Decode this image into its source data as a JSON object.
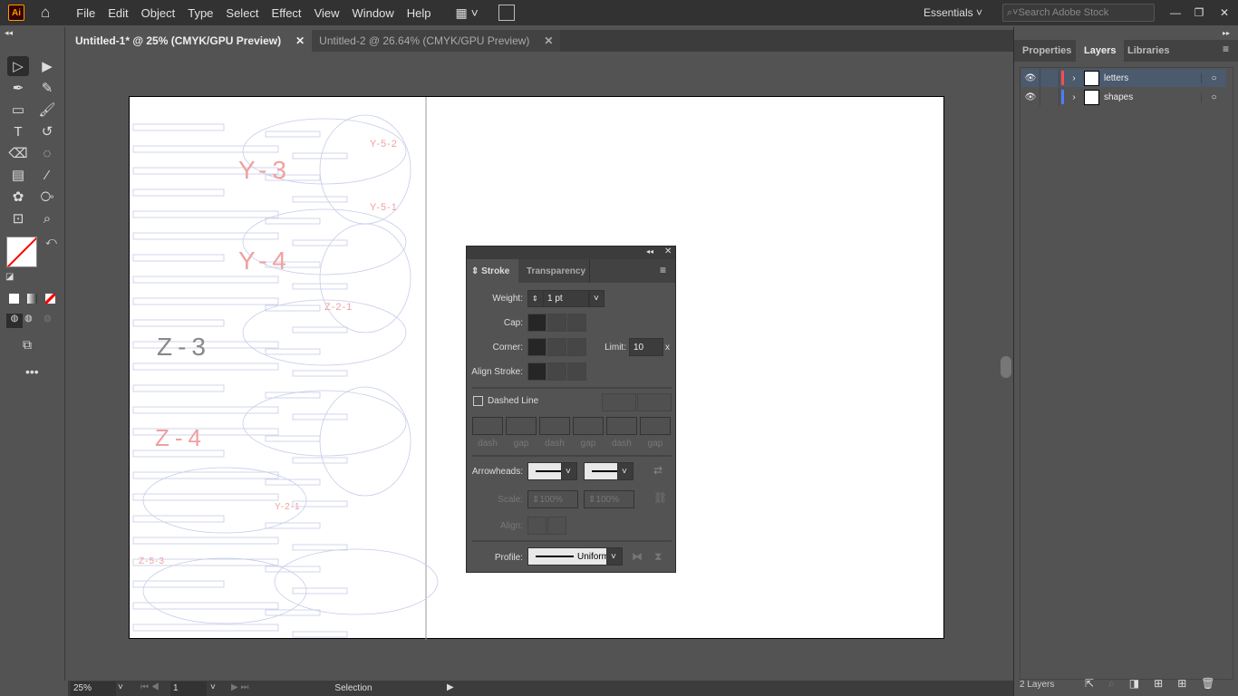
{
  "app": {
    "logo": "Ai",
    "workspace": "Essentials",
    "search_placeholder": "Search Adobe Stock"
  },
  "menu": [
    "File",
    "Edit",
    "Object",
    "Type",
    "Select",
    "Effect",
    "View",
    "Window",
    "Help"
  ],
  "tabs": [
    {
      "label": "Untitled-1* @ 25% (CMYK/GPU Preview)",
      "active": true
    },
    {
      "label": "Untitled-2 @ 26.64% (CMYK/GPU Preview)",
      "active": false
    }
  ],
  "tools": [
    "selection-tool",
    "direct-selection-tool",
    "pen-tool",
    "curvature-tool",
    "rectangle-tool",
    "paintbrush-tool",
    "type-tool",
    "rotate-tool",
    "eraser-tool",
    "puppet-warp-tool",
    "gradient-tool",
    "eyedropper-tool",
    "symbol-sprayer-tool",
    "shape-builder-tool",
    "artboard-tool",
    "zoom-tool"
  ],
  "artwork": {
    "labels": [
      "Y-3",
      "Y-4",
      "Z-3",
      "Z-4",
      "Y-5-2",
      "Y-5-1",
      "Z-2-1",
      "Z-5-3",
      "Y-2-1"
    ]
  },
  "stroke_panel": {
    "tabs": [
      "Stroke",
      "Transparency"
    ],
    "weight_label": "Weight:",
    "weight": "1 pt",
    "cap_label": "Cap:",
    "corner_label": "Corner:",
    "limit_label": "Limit:",
    "limit": "10",
    "limit_unit": "x",
    "align_label": "Align Stroke:",
    "dashed_label": "Dashed Line",
    "dashed_checked": false,
    "dash_labels": [
      "dash",
      "gap",
      "dash",
      "gap",
      "dash",
      "gap"
    ],
    "arrowheads_label": "Arrowheads:",
    "scale_label": "Scale:",
    "scale_start": "100%",
    "scale_end": "100%",
    "align_arrow_label": "Align:",
    "profile_label": "Profile:",
    "profile": "Uniform"
  },
  "layers_panel": {
    "tabs": [
      "Properties",
      "Layers",
      "Libraries"
    ],
    "active_tab": "Layers",
    "layers": [
      {
        "name": "letters",
        "color": "#ff4c4c",
        "selected": true
      },
      {
        "name": "shapes",
        "color": "#4c7cff",
        "selected": false
      }
    ],
    "count": "2 Layers"
  },
  "status": {
    "zoom": "25%",
    "artboard": "1",
    "tool": "Selection"
  }
}
